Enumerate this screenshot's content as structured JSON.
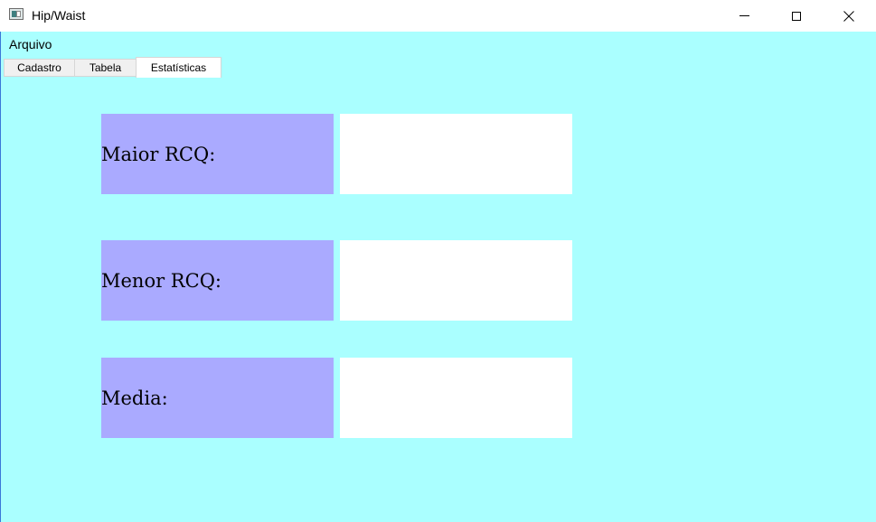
{
  "window": {
    "title": "Hip/Waist"
  },
  "menu": {
    "file_label": "Arquivo"
  },
  "tabs": [
    {
      "label": "Cadastro",
      "selected": false
    },
    {
      "label": "Tabela",
      "selected": false
    },
    {
      "label": "Estatísticas",
      "selected": true
    }
  ],
  "stats": {
    "max_label": "Maior RCQ:",
    "max_value": "",
    "min_label": "Menor RCQ:",
    "min_value": "",
    "avg_label": "Media:",
    "avg_value": ""
  },
  "colors": {
    "background": "#aaffff",
    "label_bg": "#aaaaff",
    "value_bg": "#ffffff"
  }
}
